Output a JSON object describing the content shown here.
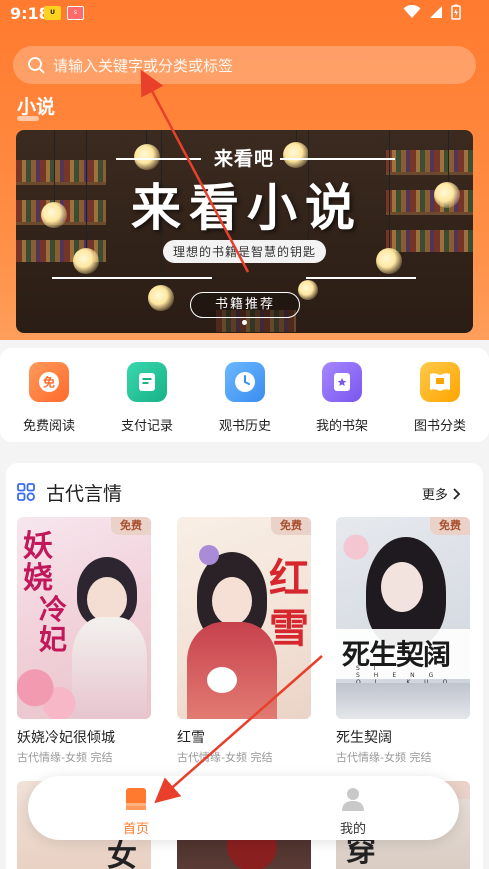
{
  "status_bar": {
    "time": "9:18"
  },
  "search": {
    "placeholder": "请输入关键字或分类或标签"
  },
  "section": {
    "title": "小说"
  },
  "banner": {
    "top_text": "来看吧",
    "big_text": "来看小说",
    "subtitle": "理想的书籍是智慧的钥匙",
    "button": "书籍推荐",
    "dot_count": 1
  },
  "quick_actions": [
    {
      "label": "免费阅读",
      "icon": "free-icon",
      "color": "#ff7a3d"
    },
    {
      "label": "支付记录",
      "icon": "receipt-icon",
      "color": "#26c49a"
    },
    {
      "label": "观书历史",
      "icon": "clock-icon",
      "color": "#4aa3ff"
    },
    {
      "label": "我的书架",
      "icon": "bookshelf-icon",
      "color": "#8f6cf5"
    },
    {
      "label": "图书分类",
      "icon": "book-category-icon",
      "color": "#ffb21f"
    }
  ],
  "category": {
    "title": "古代言情",
    "more": "更多",
    "books": [
      {
        "title": "妖娆冷妃很倾城",
        "meta": "古代情缘-女频 完结",
        "badge": "免费"
      },
      {
        "title": "红雪",
        "meta": "古代情缘-女频 完结",
        "badge": "免费"
      },
      {
        "title": "死生契阔",
        "meta": "古代情缘-女频 完结",
        "badge": "免费"
      }
    ]
  },
  "tabbar": {
    "home": "首页",
    "mine": "我的",
    "active_color": "#ff7a2e"
  }
}
